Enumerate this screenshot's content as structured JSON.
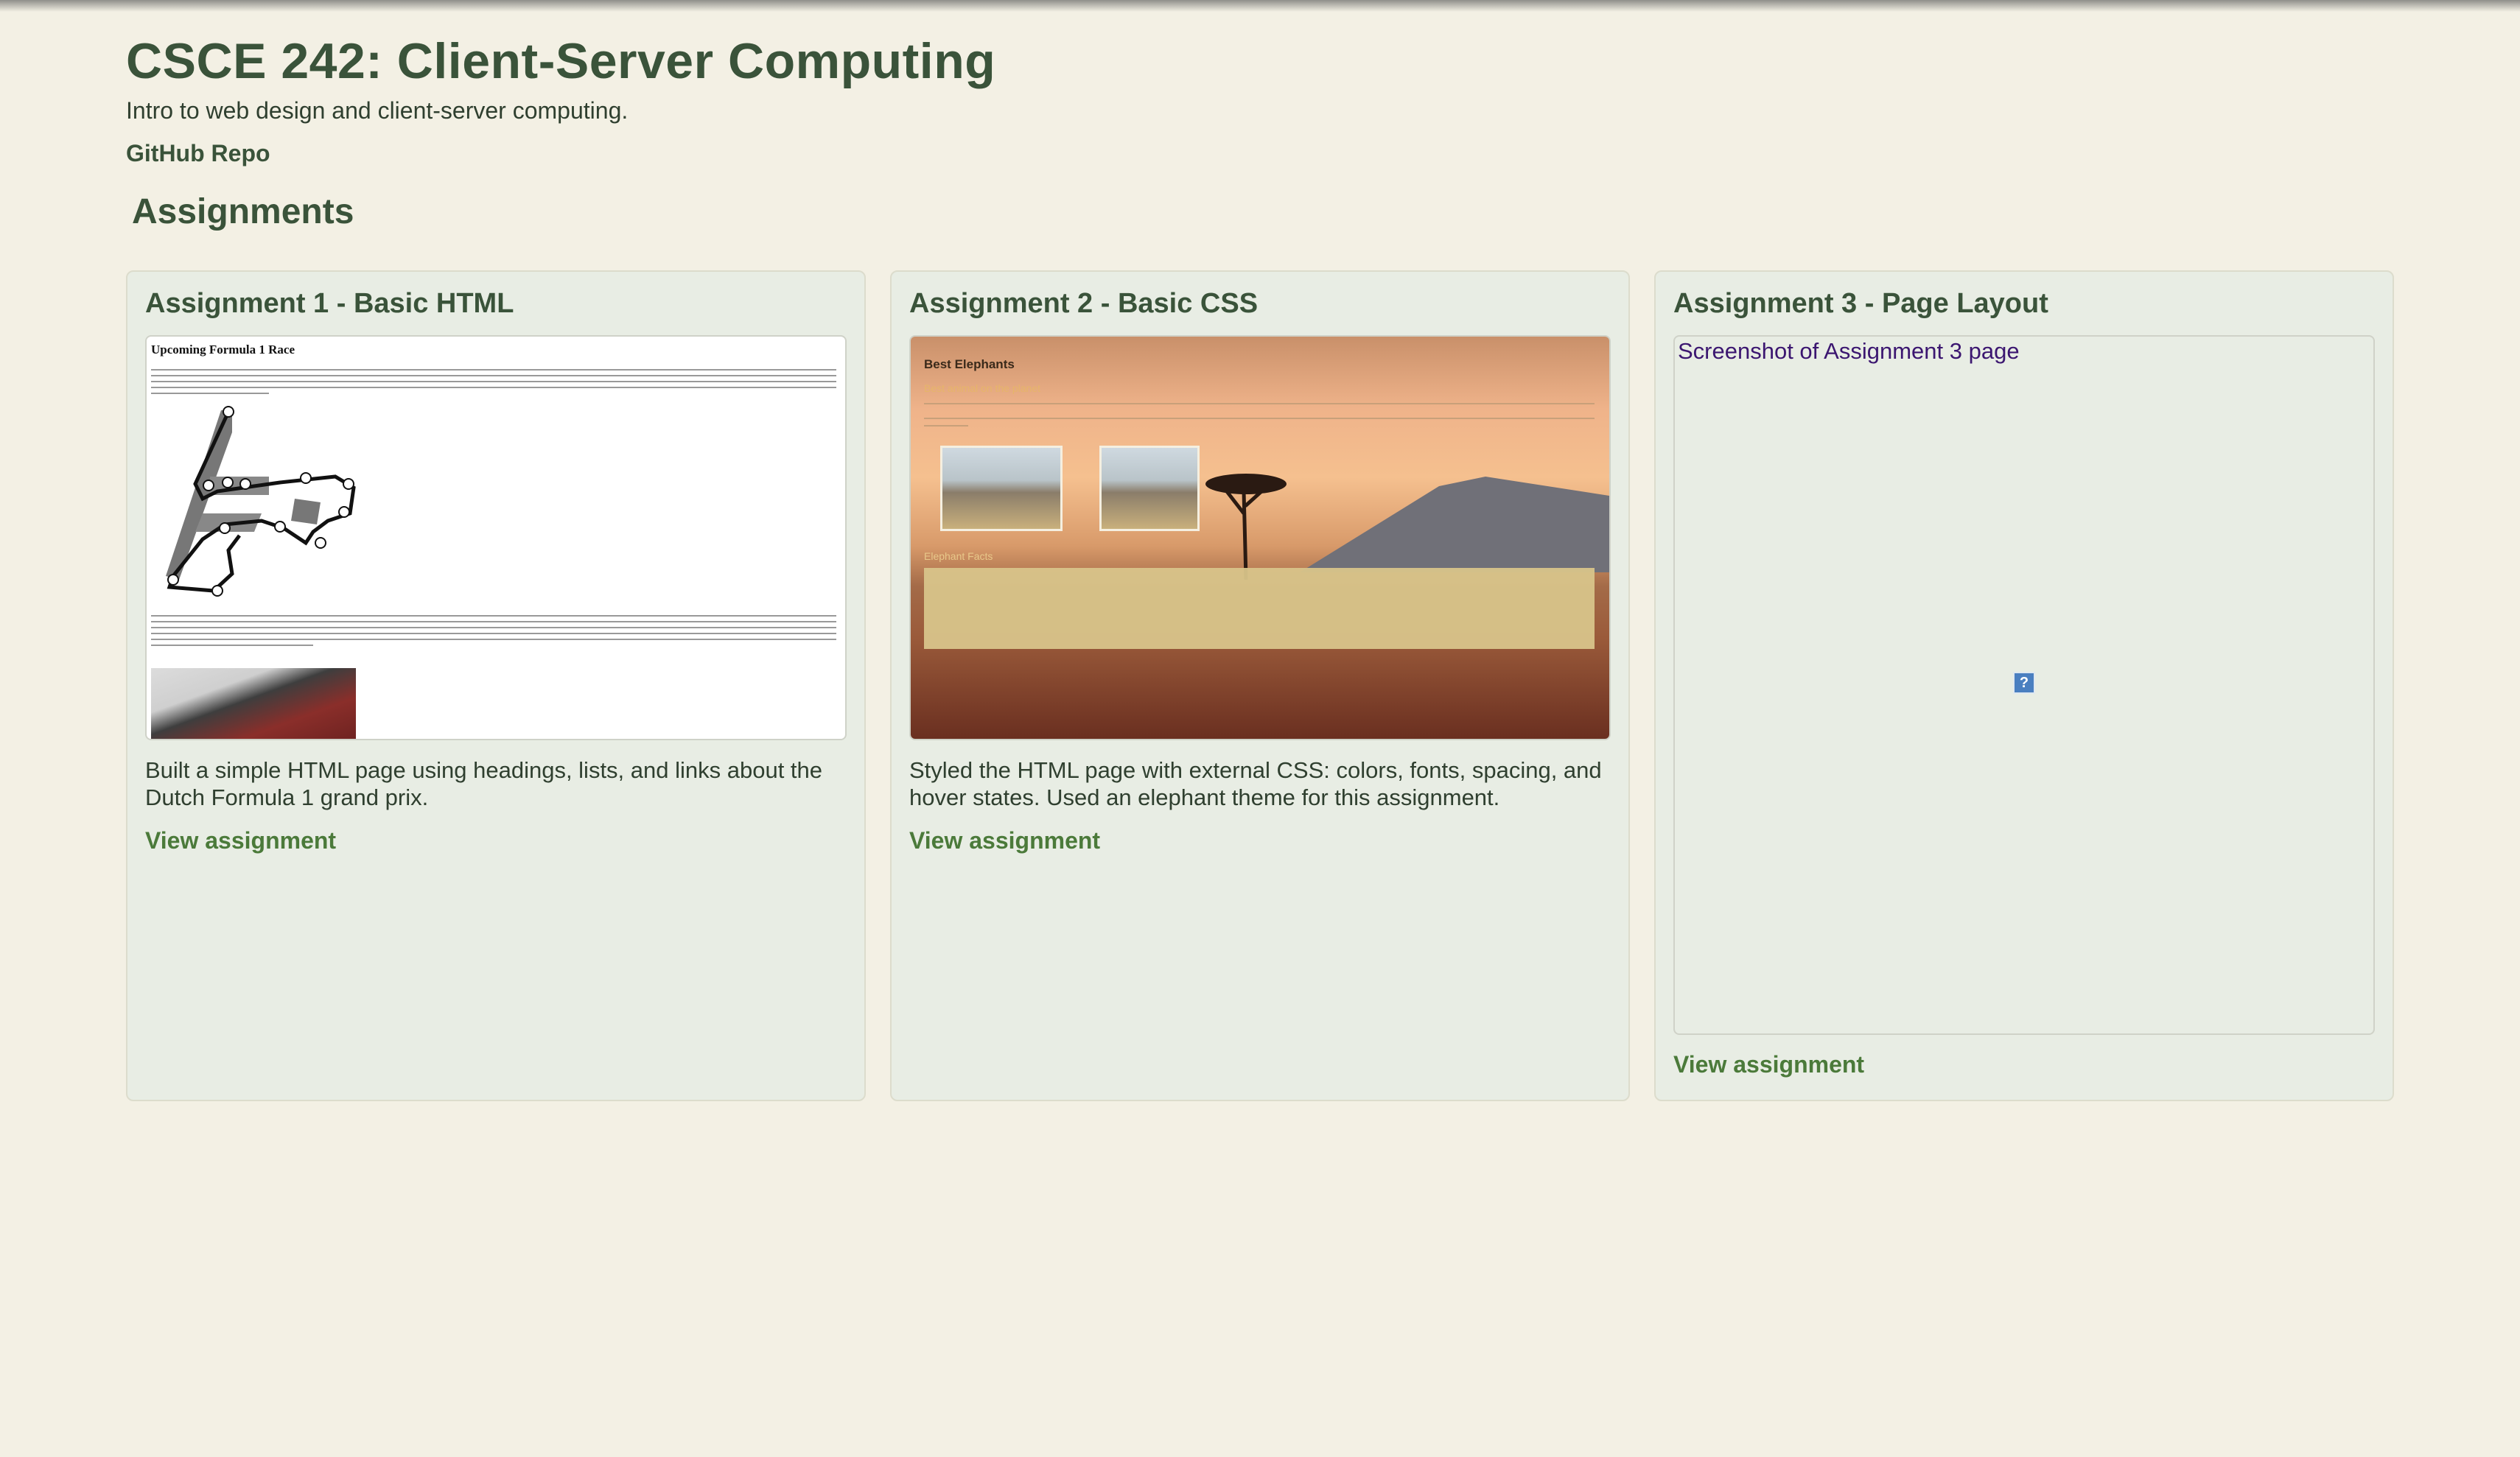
{
  "header": {
    "title": "CSCE 242: Client-Server Computing",
    "subtitle": "Intro to web design and client-server computing.",
    "repo_link": "GitHub Repo"
  },
  "section_title": "Assignments",
  "cards": [
    {
      "title": "Assignment 1 - Basic HTML",
      "screenshot": {
        "heading": "Upcoming Formula 1 Race"
      },
      "description": "Built a simple HTML page using headings, lists, and links about the Dutch Formula 1 grand prix.",
      "link": "View assignment"
    },
    {
      "title": "Assignment 2 - Basic CSS",
      "screenshot": {
        "heading": "Best Elephants",
        "subheading": "Best animal on the planet",
        "table_heading": "Elephant Facts"
      },
      "description": "Styled the HTML page with external CSS: colors, fonts, spacing, and hover states. Used an elephant theme for this assignment.",
      "link": "View assignment"
    },
    {
      "title": "Assignment 3 - Page Layout",
      "screenshot": {
        "alt_text": "Screenshot of Assignment 3 page",
        "broken_glyph": "?"
      },
      "link": "View assignment"
    }
  ],
  "colors": {
    "background": "#f3f0e4",
    "card": "#e8ede4",
    "heading": "#3a533a",
    "link": "#4b7a3a"
  }
}
